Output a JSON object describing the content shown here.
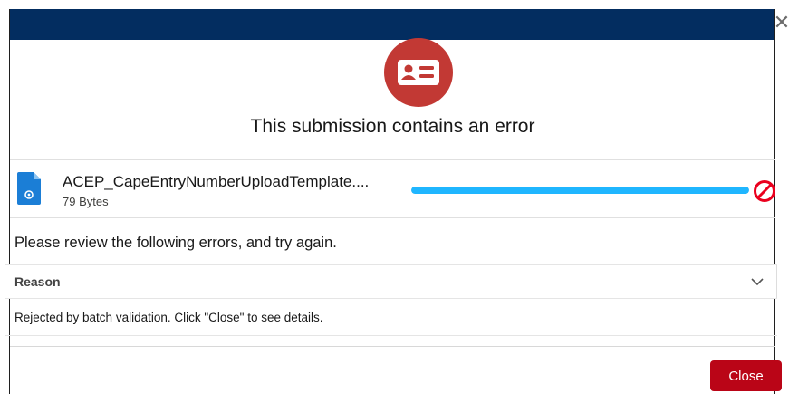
{
  "modal": {
    "title": "This submission contains an error",
    "header_color": "#032d60",
    "close_icon": "close-x-icon",
    "badge_icon": "contact-card-icon",
    "badge_color": "#c23934"
  },
  "file": {
    "name": "ACEP_CapeEntryNumberUploadTemplate....",
    "size": "79 Bytes",
    "icon": "file-icon",
    "progress_percent": 100,
    "progress_color": "#1fb6ff",
    "status_icon": "ban-icon",
    "status_color": "#ea001e"
  },
  "errors": {
    "instructions": "Please review the following errors, and try again.",
    "column_header": "Reason",
    "rows": [
      "Rejected by batch validation. Click \"Close\" to see details."
    ]
  },
  "footer": {
    "close_label": "Close",
    "close_color": "#ba0517"
  }
}
